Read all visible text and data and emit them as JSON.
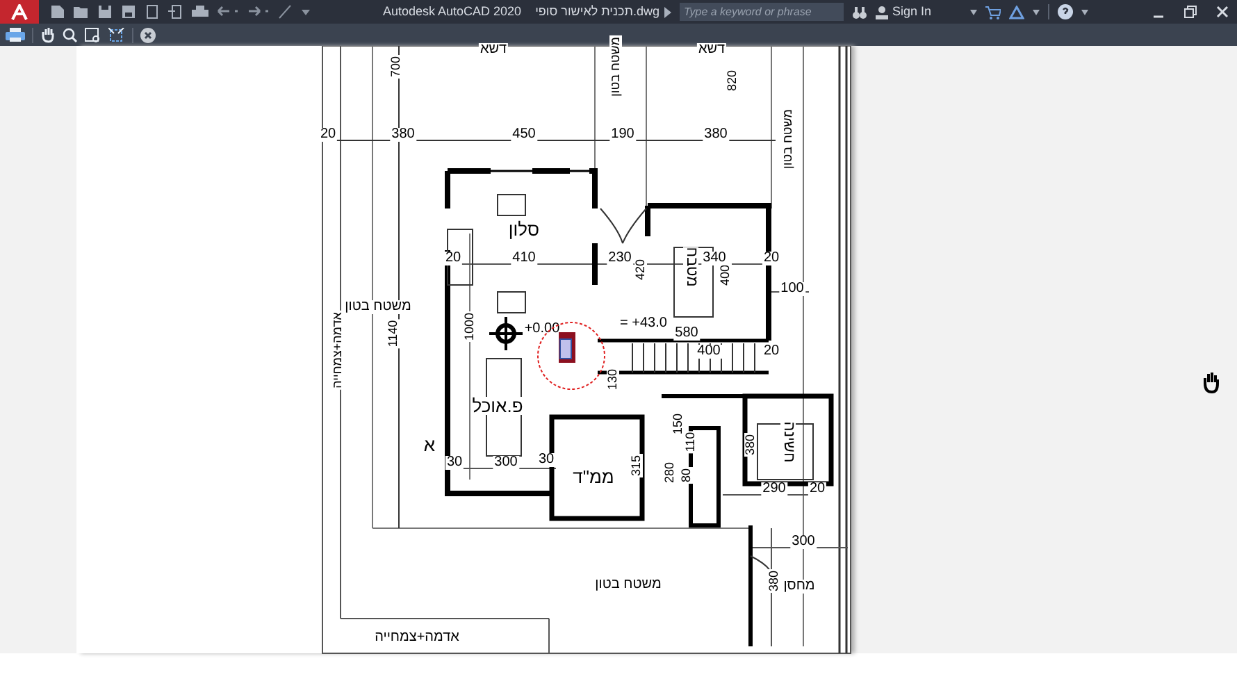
{
  "title_bar": {
    "app_title": "Autodesk AutoCAD 2020",
    "file_name": "תכנית לאישור סופי.dwg",
    "search": {
      "placeholder": "Type a keyword or phrase"
    },
    "sign_in": "Sign In"
  },
  "plan": {
    "labels": [
      {
        "text": "820",
        "kind": "vertical"
      },
      {
        "text": "דשא",
        "kind": "horizontal"
      },
      {
        "text": "משטח בטון",
        "kind": "vertical"
      },
      {
        "text": "דשא",
        "kind": "horizontal"
      },
      {
        "text": "700",
        "kind": "vertical"
      },
      {
        "text": "משטח בטון",
        "kind": "vertical"
      },
      {
        "text": "380",
        "kind": "horizontal"
      },
      {
        "text": "190",
        "kind": "horizontal"
      },
      {
        "text": "450",
        "kind": "horizontal"
      },
      {
        "text": "380",
        "kind": "horizontal"
      },
      {
        "text": "20",
        "kind": "horizontal"
      },
      {
        "text": "סלון",
        "kind": "room"
      },
      {
        "text": "20",
        "kind": "horizontal"
      },
      {
        "text": "400",
        "kind": "vertical"
      },
      {
        "text": "340",
        "kind": "horizontal"
      },
      {
        "text": "מטבח",
        "kind": "room_vertical"
      },
      {
        "text": "420",
        "kind": "vertical"
      },
      {
        "text": "230",
        "kind": "horizontal"
      },
      {
        "text": "410",
        "kind": "horizontal"
      },
      {
        "text": "20",
        "kind": "horizontal"
      },
      {
        "text": "100",
        "kind": "horizontal"
      },
      {
        "text": "580",
        "kind": "horizontal"
      },
      {
        "text": "= +43.0",
        "kind": "horizontal"
      },
      {
        "text": "+0.00",
        "kind": "horizontal"
      },
      {
        "text": "1000",
        "kind": "vertical"
      },
      {
        "text": "1140",
        "kind": "vertical"
      },
      {
        "text": "משטח בטון",
        "kind": "horizontal"
      },
      {
        "text": "אדמה+צמחייה",
        "kind": "vertical"
      },
      {
        "text": "20",
        "kind": "horizontal"
      },
      {
        "text": "400",
        "kind": "horizontal"
      },
      {
        "text": "130",
        "kind": "vertical"
      },
      {
        "text": "פ.אוכל",
        "kind": "room"
      },
      {
        "text": "150",
        "kind": "vertical"
      },
      {
        "text": "חשינה",
        "kind": "room_vertical"
      },
      {
        "text": "380",
        "kind": "vertical"
      },
      {
        "text": "110",
        "kind": "vertical"
      },
      {
        "text": "80",
        "kind": "vertical"
      },
      {
        "text": "280",
        "kind": "vertical"
      },
      {
        "text": "315",
        "kind": "vertical"
      },
      {
        "text": "ממ\"ד",
        "kind": "room"
      },
      {
        "text": "30",
        "kind": "horizontal"
      },
      {
        "text": "300",
        "kind": "horizontal"
      },
      {
        "text": "30",
        "kind": "horizontal"
      },
      {
        "text": "א",
        "kind": "room"
      },
      {
        "text": "20",
        "kind": "horizontal"
      },
      {
        "text": "290",
        "kind": "horizontal"
      },
      {
        "text": "300",
        "kind": "horizontal"
      },
      {
        "text": "מחסן",
        "kind": "horizontal"
      },
      {
        "text": "380",
        "kind": "vertical"
      },
      {
        "text": "משטח בטון",
        "kind": "horizontal"
      },
      {
        "text": "אדמה+צמחייה",
        "kind": "horizontal"
      }
    ]
  }
}
